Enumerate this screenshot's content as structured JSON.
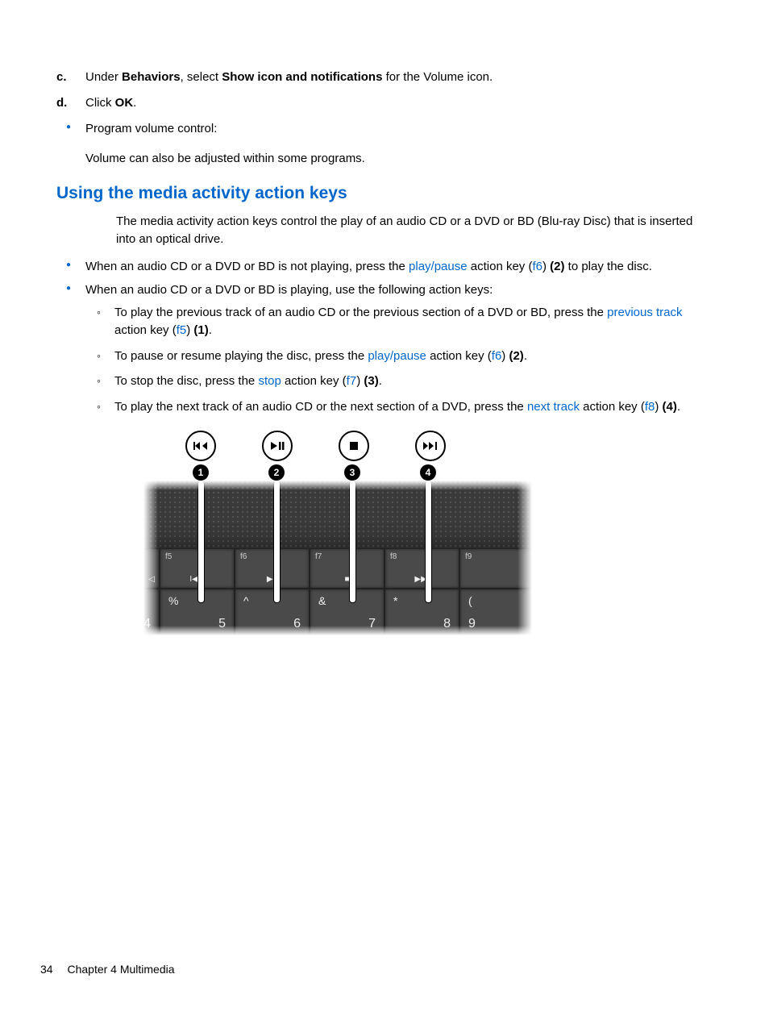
{
  "steps": {
    "c": {
      "letter": "c.",
      "pre": "Under ",
      "bold1": "Behaviors",
      "mid": ", select ",
      "bold2": "Show icon and notifications",
      "post": " for the Volume icon."
    },
    "d": {
      "letter": "d.",
      "pre": "Click ",
      "bold1": "OK",
      "post": "."
    }
  },
  "bullet_program": "Program volume control:",
  "bullet_program_sub": "Volume can also be adjusted within some programs.",
  "heading": "Using the media activity action keys",
  "intro": "The media activity action keys control the play of an audio CD or a DVD or BD (Blu-ray Disc) that is inserted into an optical drive.",
  "b1": {
    "pre": "When an audio CD or a DVD or BD is not playing, press the ",
    "link1": "play/pause",
    "mid": " action key (",
    "link2": "f6",
    "post1": ") ",
    "bold": "(2)",
    "post2": " to play the disc."
  },
  "b2": "When an audio CD or a DVD or BD is playing, use the following action keys:",
  "sub": {
    "s1": {
      "pre": "To play the previous track of an audio CD or the previous section of a DVD or BD, press the ",
      "link1": "previous track",
      "mid": " action key (",
      "link2": "f5",
      "post1": ") ",
      "bold": "(1)",
      "post2": "."
    },
    "s2": {
      "pre": "To pause or resume playing the disc, press the ",
      "link1": "play/pause",
      "mid": " action key (",
      "link2": "f6",
      "post1": ") ",
      "bold": "(2)",
      "post2": "."
    },
    "s3": {
      "pre": "To stop the disc, press the ",
      "link1": "stop",
      "mid": " action key (",
      "link2": "f7",
      "post1": ") ",
      "bold": "(3)",
      "post2": "."
    },
    "s4": {
      "pre": "To play the next track of an audio CD or the next section of a DVD, press the ",
      "link1": "next track",
      "mid": " action key (",
      "link2": "f8",
      "post1": ") ",
      "bold": "(4)",
      "post2": "."
    }
  },
  "diagram": {
    "badges": [
      "1",
      "2",
      "3",
      "4"
    ],
    "fn_keys": [
      {
        "label": "f5",
        "glyph": "I◀◀"
      },
      {
        "label": "f6",
        "glyph": "▶II"
      },
      {
        "label": "f7",
        "glyph": "■"
      },
      {
        "label": "f8",
        "glyph": "▶▶I"
      },
      {
        "label": "f9",
        "glyph": ""
      }
    ],
    "num_keys": [
      {
        "sym": "",
        "num": "4",
        "partial": true
      },
      {
        "sym": "%",
        "num": "5"
      },
      {
        "sym": "^",
        "num": "6"
      },
      {
        "sym": "&",
        "num": "7"
      },
      {
        "sym": "*",
        "num": "8"
      },
      {
        "sym": "(",
        "num": "9",
        "partial": true
      }
    ]
  },
  "footer": {
    "page": "34",
    "chapter": "Chapter 4   Multimedia"
  }
}
